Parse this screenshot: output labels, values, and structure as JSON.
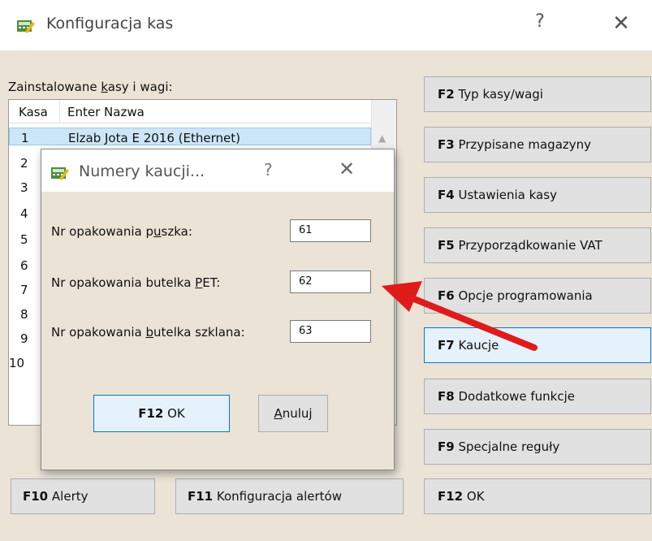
{
  "window": {
    "title": "Konfiguracja kas",
    "help": "?",
    "close": "✕"
  },
  "list": {
    "label_pre": "Zainstalowane ",
    "label_u": "k",
    "label_post": "asy i wagi:",
    "headers": {
      "kasa": "Kasa",
      "nazwa": "Enter Nazwa"
    },
    "rows": [
      {
        "num": "1",
        "name": "Elzab Jota E 2016 (Ethernet)"
      },
      {
        "num": "2",
        "name": ""
      },
      {
        "num": "3",
        "name": ""
      },
      {
        "num": "4",
        "name": ""
      },
      {
        "num": "5",
        "name": ""
      },
      {
        "num": "6",
        "name": ""
      },
      {
        "num": "7",
        "name": ""
      },
      {
        "num": "8",
        "name": ""
      },
      {
        "num": "9",
        "name": ""
      },
      {
        "num": "10",
        "name": ""
      }
    ]
  },
  "side_buttons": [
    {
      "key": "F2",
      "label": "Typ kasy/wagi"
    },
    {
      "key": "F3",
      "label": "Przypisane magazyny"
    },
    {
      "key": "F4",
      "label": "Ustawienia kasy"
    },
    {
      "key": "F5",
      "label": "Przyporządkowanie VAT"
    },
    {
      "key": "F6",
      "label": "Opcje programowania"
    },
    {
      "key": "F7",
      "label": "Kaucje"
    },
    {
      "key": "F8",
      "label": "Dodatkowe funkcje"
    },
    {
      "key": "F9",
      "label": "Specjalne reguły"
    },
    {
      "key": "F12",
      "label": "OK"
    }
  ],
  "bottom_buttons": [
    {
      "key": "F10",
      "label": "Alerty"
    },
    {
      "key": "F11",
      "label": "Konfiguracja alertów"
    }
  ],
  "dialog": {
    "title": "Numery kaucji...",
    "help": "?",
    "close": "✕",
    "fields": [
      {
        "pre": "Nr opakowania p",
        "u": "u",
        "post": "szka:",
        "value": "61"
      },
      {
        "pre": "Nr opakowania butelka ",
        "u": "P",
        "post": "ET:",
        "value": "62"
      },
      {
        "pre": "Nr opakowania ",
        "u": "b",
        "post": "utelka szklana:",
        "value": "63"
      }
    ],
    "ok": {
      "key": "F12",
      "label": "OK"
    },
    "cancel": {
      "u": "A",
      "post": "nuluj"
    }
  },
  "colors": {
    "accent": "#0078d7",
    "arrow": "#e01b1b",
    "background": "#ebe3d6"
  }
}
